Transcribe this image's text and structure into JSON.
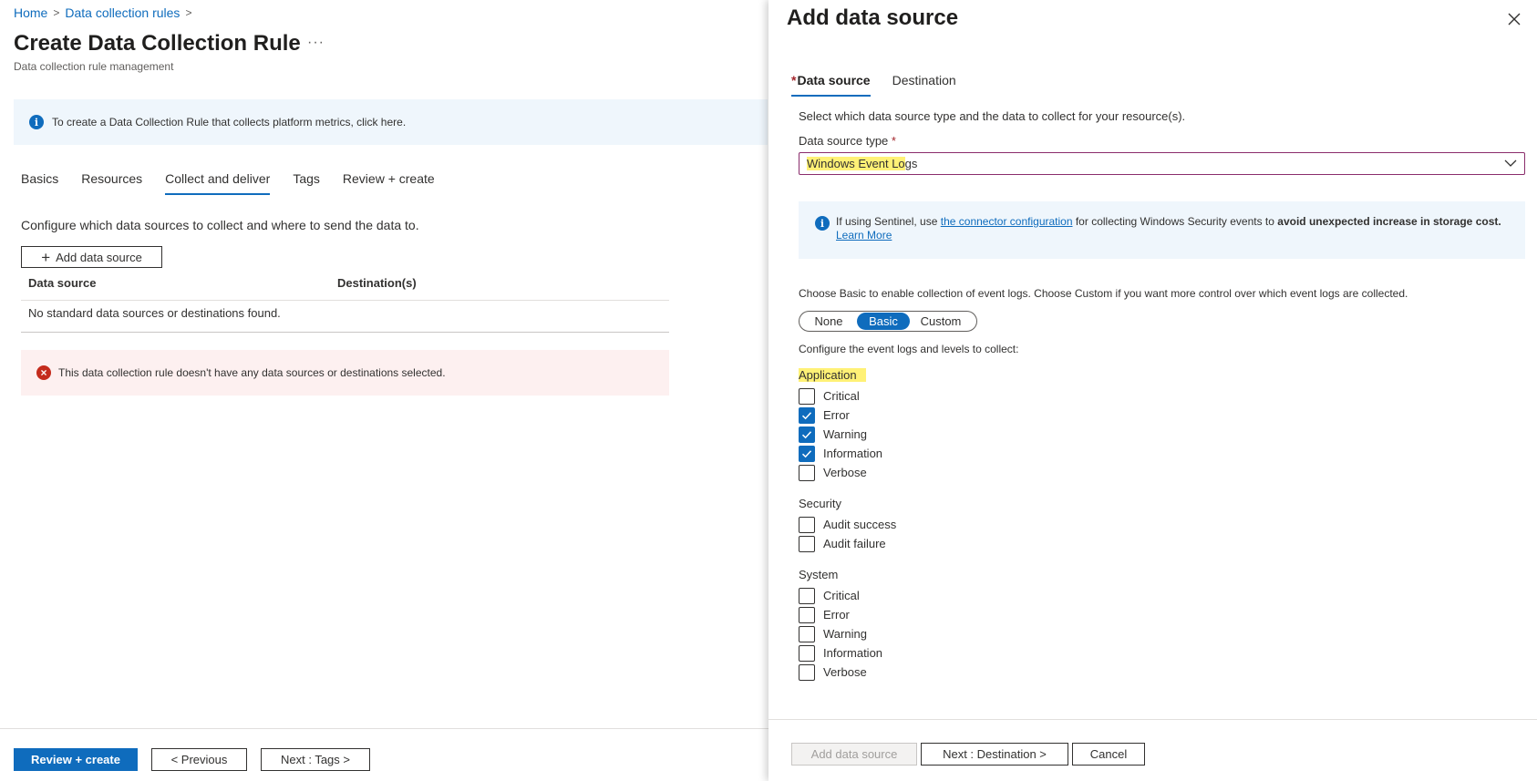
{
  "breadcrumb": {
    "home": "Home",
    "parent": "Data collection rules"
  },
  "page": {
    "title": "Create Data Collection Rule",
    "more": "···",
    "subtitle": "Data collection rule management"
  },
  "info_banner": {
    "text": "To create a Data Collection Rule that collects platform metrics, click here."
  },
  "wizard_tabs": [
    {
      "label": "Basics",
      "active": false
    },
    {
      "label": "Resources",
      "active": false
    },
    {
      "label": "Collect and deliver",
      "active": true
    },
    {
      "label": "Tags",
      "active": false
    },
    {
      "label": "Review + create",
      "active": false
    }
  ],
  "collect": {
    "description": "Configure which data sources to collect and where to send the data to.",
    "add_button": "Add data source",
    "columns": [
      "Data source",
      "Destination(s)"
    ],
    "empty_message": "No standard data sources or destinations found.",
    "error_message": "This data collection rule doesn't have any data sources or destinations selected."
  },
  "footer": {
    "review": "Review + create",
    "previous": "< Previous",
    "next": "Next : Tags >"
  },
  "panel": {
    "title": "Add data source",
    "tabs": [
      {
        "label": "Data source",
        "required": true,
        "active": true
      },
      {
        "label": "Destination",
        "required": false,
        "active": false
      }
    ],
    "instructions": "Select which data source type and the data to collect for your resource(s).",
    "type_label": "Data source type",
    "required_mark": "*",
    "type_value_highlight": "Windows Event Lo",
    "type_value_rest": "gs",
    "sentinel": {
      "prefix": "If using Sentinel, use ",
      "link": "the connector configuration",
      "middle": " for collecting Windows Security events to ",
      "bold": "avoid unexpected increase in storage cost.",
      "learn_more": "Learn More"
    },
    "choose_text": "Choose Basic to enable collection of event logs. Choose Custom if you want more control over which event logs are collected.",
    "modes": [
      {
        "label": "None",
        "active": false
      },
      {
        "label": "Basic",
        "active": true
      },
      {
        "label": "Custom",
        "active": false
      }
    ],
    "configure_text": "Configure the event logs and levels to collect:",
    "groups": [
      {
        "title": "Application",
        "highlight": true,
        "items": [
          {
            "label": "Critical",
            "checked": false
          },
          {
            "label": "Error",
            "checked": true
          },
          {
            "label": "Warning",
            "checked": true
          },
          {
            "label": "Information",
            "checked": true
          },
          {
            "label": "Verbose",
            "checked": false
          }
        ]
      },
      {
        "title": "Security",
        "highlight": false,
        "items": [
          {
            "label": "Audit success",
            "checked": false
          },
          {
            "label": "Audit failure",
            "checked": false
          }
        ]
      },
      {
        "title": "System",
        "highlight": false,
        "items": [
          {
            "label": "Critical",
            "checked": false
          },
          {
            "label": "Error",
            "checked": false
          },
          {
            "label": "Warning",
            "checked": false
          },
          {
            "label": "Information",
            "checked": false
          },
          {
            "label": "Verbose",
            "checked": false
          }
        ]
      }
    ],
    "footer": {
      "add": "Add data source",
      "next": "Next : Destination >",
      "cancel": "Cancel"
    }
  },
  "colors": {
    "accent": "#0f6cbd",
    "highlight": "#fff176",
    "error": "#c42b1c",
    "info_bg": "#eff6fc",
    "error_bg": "#fdf0f0"
  }
}
